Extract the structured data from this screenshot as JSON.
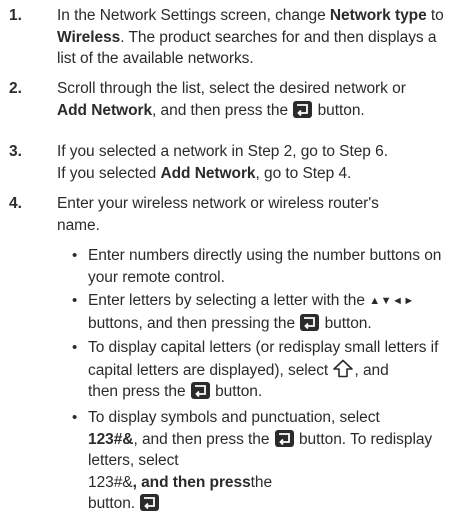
{
  "steps": [
    {
      "num": "1.",
      "parts": [
        "In the Network Settings screen, change ",
        "Network type",
        " to ",
        "Wireless",
        ". The product searches for and then displays a list of the available networks."
      ]
    },
    {
      "num": "2.",
      "parts": [
        "Scroll through the list, select the desired network or",
        "Add Network",
        ", and then press the",
        "button."
      ]
    },
    {
      "num": "3.",
      "parts": [
        "If you selected a network in Step 2, go to Step 6.",
        "If you selected ",
        "Add Network",
        ", go to Step 4."
      ]
    },
    {
      "num": "4.",
      "parts": [
        "Enter your wireless network or wireless router's name."
      ]
    }
  ],
  "bullets": [
    {
      "dot": "•",
      "text": "Enter numbers directly using the number buttons on your remote control."
    },
    {
      "dot": "•",
      "parts": [
        "Enter letters by selecting a letter with the",
        "▲▼◄►",
        "buttons, and then pressing the",
        "button."
      ]
    },
    {
      "dot": "•",
      "parts": [
        "To display capital letters (or redisplay small letters if capital letters are displayed), select",
        ", and",
        "then press the",
        "button."
      ]
    },
    {
      "dot": "•",
      "parts": [
        "To display symbols and punctuation, select",
        "123#&",
        ", and then press the",
        "button. To redisplay letters, select ",
        "123#&",
        ", and then press",
        "the",
        "button."
      ]
    }
  ],
  "icons": {
    "enter": "enter-button-icon",
    "shift": "shift-arrow-icon"
  },
  "colors": {
    "text": "#2b2b2b",
    "icon_bg": "#2b2b2b"
  }
}
